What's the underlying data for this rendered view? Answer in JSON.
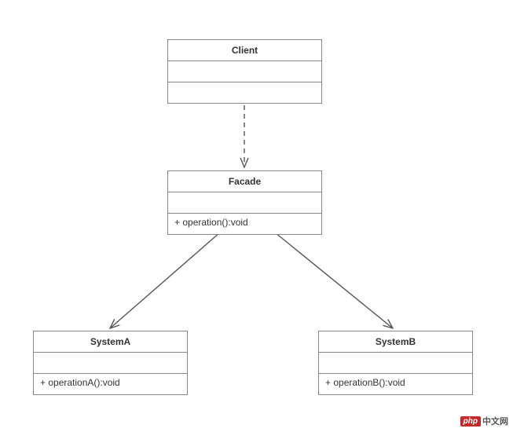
{
  "diagram": {
    "pattern": "Facade",
    "classes": {
      "client": {
        "name": "Client",
        "attributes": "",
        "operations": ""
      },
      "facade": {
        "name": "Facade",
        "attributes": "",
        "operations": "+ operation():void"
      },
      "systemA": {
        "name": "SystemA",
        "attributes": "",
        "operations": "+ operationA():void"
      },
      "systemB": {
        "name": "SystemB",
        "attributes": "",
        "operations": "+ operationB():void"
      }
    },
    "relations": [
      {
        "from": "client",
        "to": "facade",
        "type": "dependency",
        "style": "dashed-arrow"
      },
      {
        "from": "facade",
        "to": "systemA",
        "type": "association",
        "style": "solid-arrow"
      },
      {
        "from": "facade",
        "to": "systemB",
        "type": "association",
        "style": "solid-arrow"
      }
    ]
  },
  "watermark": {
    "badge": "php",
    "text": "中文网"
  }
}
